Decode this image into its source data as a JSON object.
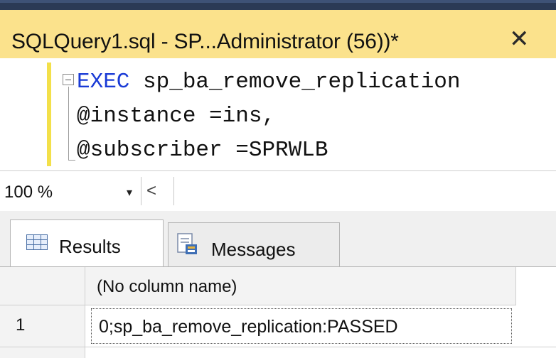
{
  "document_tab": {
    "title": "SQLQuery1.sql - SP...Administrator (56))*",
    "close_glyph": "✕"
  },
  "editor": {
    "lines": [
      {
        "keyword": "EXEC",
        "text": " sp_ba_remove_replication"
      },
      {
        "text": "@instance =ins,"
      },
      {
        "text": "@subscriber =SPRWLB"
      }
    ]
  },
  "zoom": {
    "value": "100 %",
    "dropdown_glyph": "▾",
    "scroll_left_glyph": "<"
  },
  "result_tabs": [
    {
      "label": "Results",
      "icon": "grid-icon",
      "active": true
    },
    {
      "label": "Messages",
      "icon": "messages-icon",
      "active": false
    }
  ],
  "grid": {
    "columns": [
      "(No column name)"
    ],
    "rows": [
      {
        "row_number": "1",
        "cells": [
          "0;sp_ba_remove_replication:PASSED"
        ]
      }
    ]
  },
  "colors": {
    "tab_background": "#fbe28c",
    "keyword": "#1a3bd6",
    "frame": "#2b3a55"
  }
}
